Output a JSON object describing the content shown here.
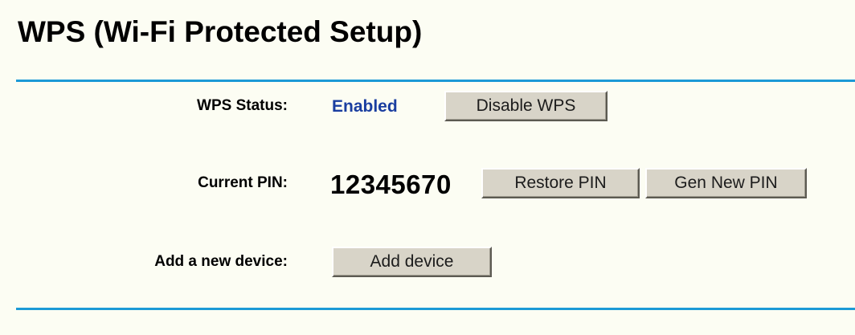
{
  "page": {
    "title": "WPS (Wi-Fi Protected Setup)"
  },
  "wps_status": {
    "label": "WPS Status:",
    "value": "Enabled",
    "disable_button": "Disable WPS"
  },
  "current_pin": {
    "label": "Current PIN:",
    "value": "12345670",
    "restore_button": "Restore PIN",
    "gen_button": "Gen New PIN"
  },
  "add_device": {
    "label": "Add a new device:",
    "button": "Add device"
  },
  "colors": {
    "accent_rule": "#1c9ad6",
    "status_text": "#1a3ea0",
    "background": "#fcfdf3"
  }
}
